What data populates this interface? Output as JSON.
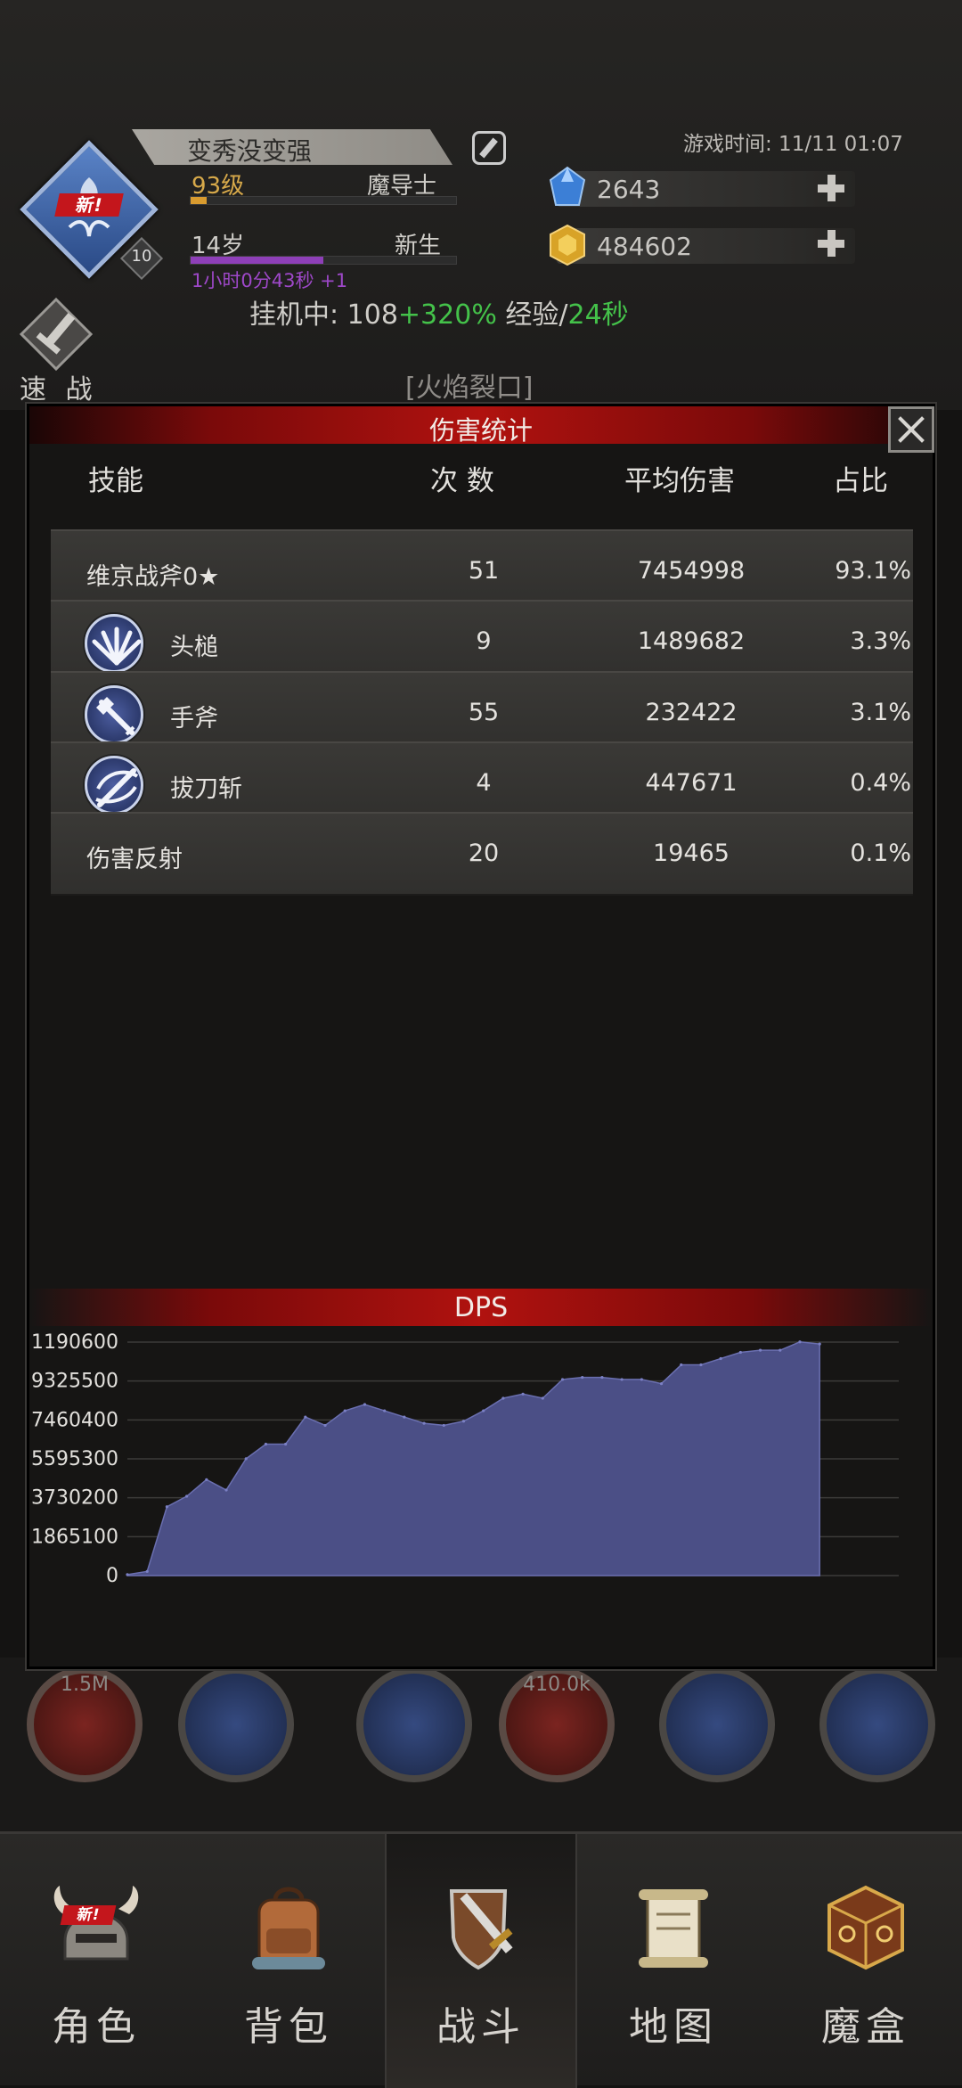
{
  "header": {
    "player_name": "变秀没变强",
    "level": "93级",
    "class": "魔导士",
    "age": "14岁",
    "stage": "新生",
    "time_gain": "1小时0分43秒 +1",
    "avatar_new_badge": "新!",
    "avatar_level": "10",
    "game_time": "游戏时间: 11/11 01:07",
    "gems": "2643",
    "gold": "484602",
    "level_progress": 0.06,
    "age_progress": 0.5,
    "idle": {
      "prefix": "挂机中: ",
      "count": "108",
      "bonus": "+320%",
      "exp_label": " 经验/",
      "exp_time": "24秒"
    },
    "quick_battle_label": "速 战",
    "zone": "[火焰裂口]"
  },
  "background_skills": [
    "1.5M",
    "",
    "",
    "410.0k",
    "",
    ""
  ],
  "modal": {
    "title": "伤害统计",
    "columns": {
      "skill": "技能",
      "count": "次 数",
      "avg": "平均伤害",
      "pct": "占比"
    },
    "rows": [
      {
        "name": "维京战斧0★",
        "count": "51",
        "avg": "7454998",
        "pct": "93.1%",
        "icon": null
      },
      {
        "name": "头槌",
        "count": "9",
        "avg": "1489682",
        "pct": "3.3%",
        "icon": "headbutt-icon"
      },
      {
        "name": "手斧",
        "count": "55",
        "avg": "232422",
        "pct": "3.1%",
        "icon": "hand-axe-icon"
      },
      {
        "name": "拔刀斩",
        "count": "4",
        "avg": "447671",
        "pct": "0.4%",
        "icon": "draw-slash-icon"
      },
      {
        "name": "伤害反射",
        "count": "20",
        "avg": "19465",
        "pct": "0.1%",
        "icon": null
      }
    ],
    "dps_title": "DPS"
  },
  "chart_data": {
    "type": "area",
    "title": "DPS",
    "y_ticks": [
      "0",
      "1865100",
      "3730200",
      "5595300",
      "7460400",
      "9325500",
      "11190600"
    ],
    "x_ticks": [
      "0",
      "13",
      "26",
      "39"
    ],
    "ylim": [
      0,
      11190600
    ],
    "xlim": [
      0,
      39
    ],
    "x": [
      0,
      1,
      2,
      3,
      4,
      5,
      6,
      7,
      8,
      9,
      10,
      11,
      12,
      13,
      14,
      15,
      16,
      17,
      18,
      19,
      20,
      21,
      22,
      23,
      24,
      25,
      26,
      27,
      28,
      29,
      30,
      31,
      32,
      33,
      34,
      35
    ],
    "values": [
      50000,
      200000,
      3300000,
      3800000,
      4600000,
      4100000,
      5600000,
      6300000,
      6300000,
      7600000,
      7200000,
      7900000,
      8200000,
      7900000,
      7600000,
      7300000,
      7200000,
      7400000,
      7900000,
      8500000,
      8700000,
      8500000,
      9400000,
      9500000,
      9500000,
      9400000,
      9400000,
      9200000,
      10100000,
      10100000,
      10400000,
      10700000,
      10800000,
      10800000,
      11200000,
      11100000
    ],
    "fill_color": "#4b4f86",
    "grid": true
  },
  "nav": {
    "items": [
      {
        "label": "角色",
        "new_badge": "新!"
      },
      {
        "label": "背包"
      },
      {
        "label": "战斗"
      },
      {
        "label": "地图"
      },
      {
        "label": "魔盒"
      }
    ],
    "active_index": 2
  }
}
